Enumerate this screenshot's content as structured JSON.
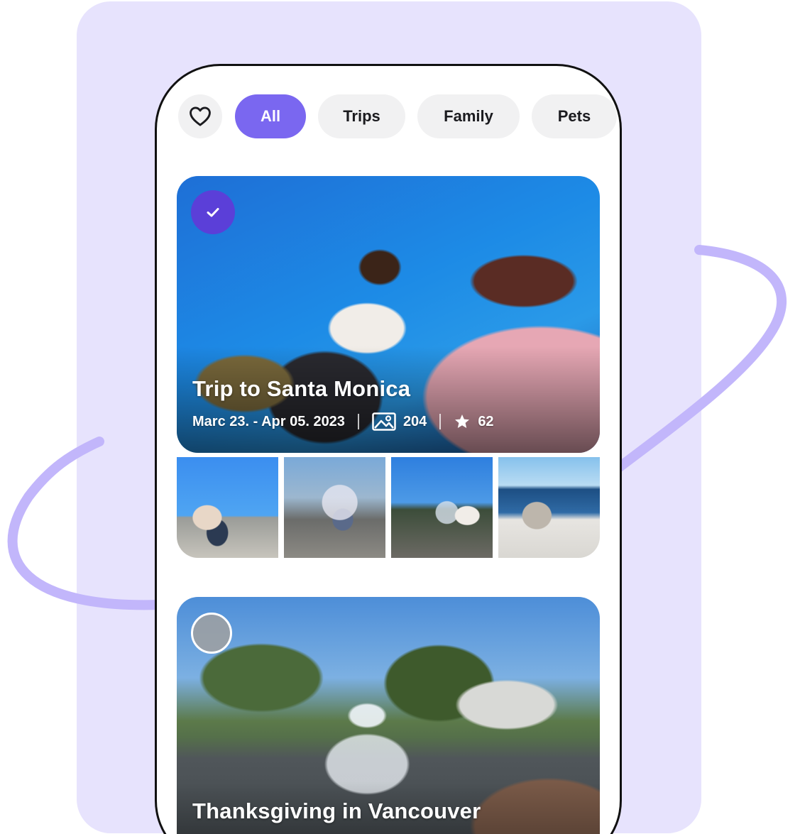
{
  "colors": {
    "background_panel": "#e7e3fd",
    "orbit": "#c2b6fb",
    "accent": "#7a67f0",
    "check_badge": "#5b3fd8",
    "chip_bg": "#f1f1f2"
  },
  "filters": {
    "favorites_icon": "heart-icon",
    "chips": [
      {
        "label": "All",
        "selected": true
      },
      {
        "label": "Trips",
        "selected": false
      },
      {
        "label": "Family",
        "selected": false
      },
      {
        "label": "Pets",
        "selected": false
      }
    ]
  },
  "albums": [
    {
      "title": "Trip to Santa Monica",
      "selected": true,
      "date_range": "Marc 23. - Apr 05. 2023",
      "photo_count": "204",
      "favorites_count": "62",
      "photo_icon": "image-icon",
      "favorites_icon": "star-icon",
      "thumbnail_count": 4
    },
    {
      "title": "Thanksgiving in Vancouver",
      "selected": false
    }
  ]
}
